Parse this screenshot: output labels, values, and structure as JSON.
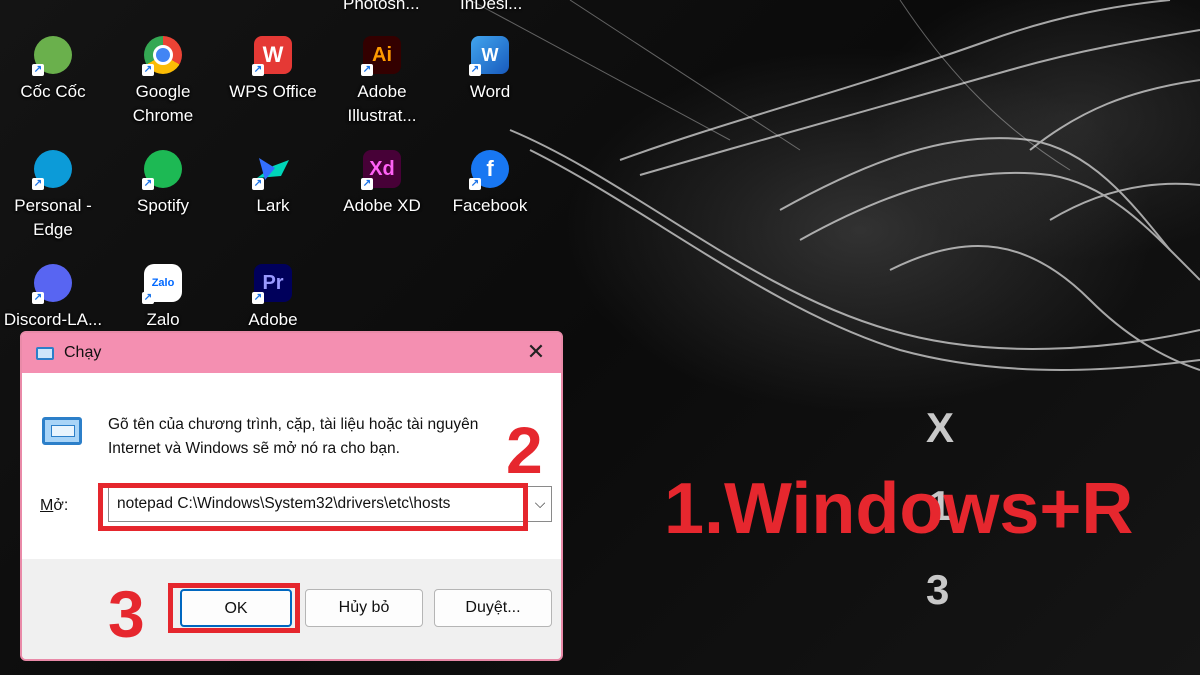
{
  "desktop": {
    "top_partial_labels": [
      "Photosh...",
      "InDesi..."
    ],
    "icons": [
      {
        "label": "Cốc Cốc",
        "icon": "coccoc-icon",
        "color": "#6ab04c"
      },
      {
        "label": "Google\nChrome",
        "icon": "chrome-icon",
        "color": "#ea4335"
      },
      {
        "label": "WPS Office",
        "icon": "wps-office-icon",
        "color": "#e53935",
        "glyph": "W"
      },
      {
        "label": "Adobe\nIllustrat...",
        "icon": "illustrator-icon",
        "color": "#ff9a00",
        "glyph": "Ai"
      },
      {
        "label": "Word",
        "icon": "word-icon",
        "color": "#2b7cd3",
        "glyph": "W"
      },
      {
        "label": "Personal -\nEdge",
        "icon": "edge-icon",
        "color": "#0c9bd8"
      },
      {
        "label": "Spotify",
        "icon": "spotify-icon",
        "color": "#1db954"
      },
      {
        "label": "Lark",
        "icon": "lark-icon",
        "color": "#3370ff"
      },
      {
        "label": "Adobe XD",
        "icon": "adobe-xd-icon",
        "color": "#ff61f6",
        "glyph": "Xd"
      },
      {
        "label": "Facebook",
        "icon": "facebook-icon",
        "color": "#1877f2",
        "glyph": "f"
      },
      {
        "label": "Discord-LA...",
        "icon": "discord-icon",
        "color": "#5865f2"
      },
      {
        "label": "Zalo",
        "icon": "zalo-icon",
        "color": "#0068ff",
        "glyph": "Zalo"
      },
      {
        "label": "Adobe",
        "icon": "premiere-icon",
        "color": "#9999ff",
        "glyph": "Pr"
      }
    ]
  },
  "run_dialog": {
    "title": "Chạy",
    "description": "Gõ tên của chương trình, cặp, tài liệu hoặc tài nguyên Internet và Windows sẽ mở nó ra cho bạn.",
    "open_label_prefix": "M",
    "open_label_rest": "ở:",
    "command_value": "notepad C:\\Windows\\System32\\drivers\\etc\\hosts",
    "ok_label": "OK",
    "cancel_label": "Hủy bỏ",
    "browse_label": "Duyệt..."
  },
  "annotations": {
    "step1": "1.Windows+R",
    "step2": "2",
    "step3": "3",
    "color": "#e6272e"
  },
  "wallpaper": {
    "logo_letters": [
      "X",
      "1",
      "3"
    ]
  }
}
